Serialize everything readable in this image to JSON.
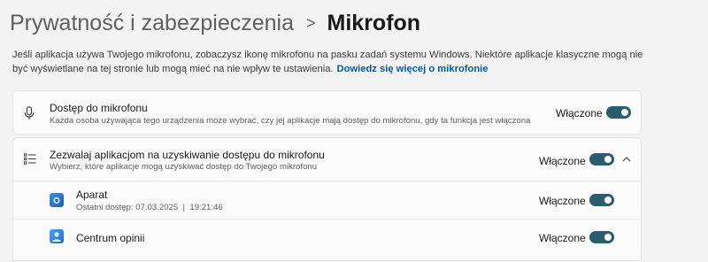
{
  "breadcrumb": {
    "parent": "Prywatność i zabezpieczenia",
    "separator": ">",
    "current": "Mikrofon"
  },
  "description": {
    "text": "Jeśli aplikacja używa Twojego mikrofonu, zobaczysz ikonę mikrofonu na pasku zadań systemu Windows. Niektóre aplikacje klasyczne mogą nie być wyświetlane na tej stronie lub mogą mieć na nie wpływ te ustawienia.",
    "link": "Dowiedz się więcej o mikrofonie"
  },
  "microphone_access": {
    "title": "Dostęp do mikrofonu",
    "subtitle": "Każda osoba używająca tego urządzenia może wybrać, czy jej aplikacje mają dostęp do mikrofonu, gdy ta funkcja jest włączona",
    "state": "Włączone",
    "icon": "microphone-icon"
  },
  "apps_access": {
    "title": "Zezwalaj aplikacjom na uzyskiwanie dostępu do mikrofonu",
    "subtitle": "Wybierz, które aplikacje mogą uzyskiwać dostęp do Twojego mikrofonu",
    "state": "Włączone",
    "icon": "list-icon",
    "expand_icon": "chevron-up-icon"
  },
  "apps": [
    {
      "name": "Aparat",
      "last_access": "Ostatni dostęp: 07.03.2025  |  19:21:46",
      "state": "Włączone",
      "icon": "camera-app-icon"
    },
    {
      "name": "Centrum opinii",
      "state": "Włączone",
      "icon": "feedback-hub-icon"
    }
  ],
  "colors": {
    "toggle_on": "#2b5c6e",
    "link": "#005a9e",
    "background": "#f3f3f3"
  }
}
